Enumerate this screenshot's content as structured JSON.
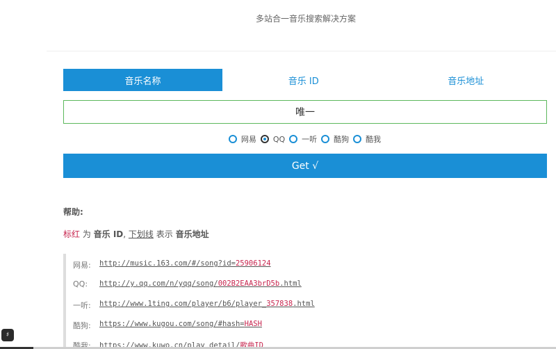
{
  "header": {
    "subtitle": "多站合一音乐搜索解决方案"
  },
  "tabs": [
    {
      "label": "音乐名称",
      "active": true
    },
    {
      "label": "音乐 ID",
      "active": false
    },
    {
      "label": "音乐地址",
      "active": false
    }
  ],
  "search": {
    "value": "唯一"
  },
  "sources": [
    {
      "label": "网易",
      "checked": false
    },
    {
      "label": "QQ",
      "checked": true
    },
    {
      "label": "一听",
      "checked": false
    },
    {
      "label": "酷狗",
      "checked": false
    },
    {
      "label": "酷我",
      "checked": false
    }
  ],
  "submit": {
    "label": "Get √"
  },
  "help": {
    "title": "帮助:",
    "legend": {
      "red_word": "标红",
      "is1": " 为 ",
      "music_id": "音乐 ID",
      "sep": ", ",
      "underline_word": "下划线",
      "is2": " 表示 ",
      "music_url": "音乐地址"
    },
    "examples": [
      {
        "label": "网易:",
        "url_prefix": "http://music.163.com/#/song?id=",
        "url_id": "25906124",
        "url_suffix": ""
      },
      {
        "label": "QQ:",
        "url_prefix": "http://y.qq.com/n/yqq/song/",
        "url_id": "002B2EAA3brD5b",
        "url_suffix": ".html"
      },
      {
        "label": "一听:",
        "url_prefix": "http://www.1ting.com/player/b6/player_",
        "url_id": "357838",
        "url_suffix": ".html"
      },
      {
        "label": "酷狗:",
        "url_prefix": "https://www.kugou.com/song/#hash=",
        "url_id": "HASH",
        "url_suffix": ""
      },
      {
        "label": "酷我:",
        "url_prefix": "https://www.kuwo.cn/play_detail/",
        "url_id": "歌曲ID",
        "url_suffix": ""
      }
    ]
  },
  "badge": {
    "text": "♯"
  },
  "colors": {
    "accent": "#1a8fd6",
    "input_border": "#5cb85c",
    "highlight_red": "#c7254e"
  }
}
